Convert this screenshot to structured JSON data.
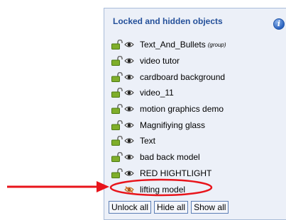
{
  "panel": {
    "title": "Locked and hidden objects",
    "info_icon": "info-icon",
    "items": [
      {
        "label": "Text_And_Bullets",
        "tag": "(group)",
        "locked": true,
        "visible": true
      },
      {
        "label": "video tutor",
        "locked": true,
        "visible": true
      },
      {
        "label": "cardboard background",
        "locked": true,
        "visible": true
      },
      {
        "label": "video_11",
        "locked": true,
        "visible": true
      },
      {
        "label": "motion graphics demo",
        "locked": true,
        "visible": true
      },
      {
        "label": "Magnifiying glass",
        "locked": true,
        "visible": true
      },
      {
        "label": "Text",
        "locked": true,
        "visible": true
      },
      {
        "label": "bad back model",
        "locked": true,
        "visible": true
      },
      {
        "label": "RED HIGHTLIGHT",
        "locked": true,
        "visible": true
      },
      {
        "label": "lifting model",
        "locked": false,
        "visible": false
      }
    ],
    "buttons": {
      "unlock_all": "Unlock all",
      "hide_all": "Hide all",
      "show_all": "Show all"
    }
  },
  "annotation": {
    "color": "#e8141b"
  }
}
